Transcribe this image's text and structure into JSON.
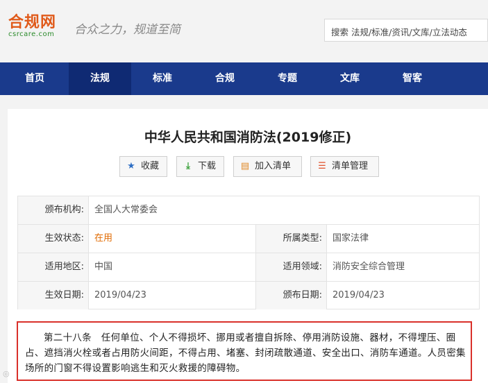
{
  "header": {
    "logo_main": "合规网",
    "logo_sub": "csrcare.com",
    "slogan": "合众之力，规道至简",
    "search_placeholder": "搜索 法规/标准/资讯/文库/立法动态"
  },
  "nav": {
    "items": [
      {
        "label": "首页"
      },
      {
        "label": "法规",
        "active": true
      },
      {
        "label": "标准"
      },
      {
        "label": "合规"
      },
      {
        "label": "专题"
      },
      {
        "label": "文库"
      },
      {
        "label": "智客"
      }
    ]
  },
  "doc": {
    "title": "中华人民共和国消防法(2019修正)",
    "actions": {
      "favorite": "收藏",
      "download": "下载",
      "add_list": "加入清单",
      "manage_list": "清单管理"
    },
    "info": {
      "issuer_label": "颁布机构:",
      "issuer": "全国人大常委会",
      "status_label": "生效状态:",
      "status": "在用",
      "type_label": "所属类型:",
      "type": "国家法律",
      "region_label": "适用地区:",
      "region": "中国",
      "field_label": "适用领域:",
      "field": "消防安全综合管理",
      "effective_label": "生效日期:",
      "effective": "2019/04/23",
      "issued_label": "颁布日期:",
      "issued": "2019/04/23"
    },
    "article": "第二十八条　任何单位、个人不得损坏、挪用或者擅自拆除、停用消防设施、器材，不得埋压、圈占、遮挡消火栓或者占用防火间距，不得占用、堵塞、封闭疏散通道、安全出口、消防车通道。人员密集场所的门窗不得设置影响逃生和灭火救援的障碍物。"
  },
  "colors": {
    "nav_bg": "#1a3a8c",
    "nav_active": "#0f2a73",
    "logo": "#e05a1a",
    "status": "#e06a00",
    "highlight_border": "#d9302a"
  }
}
